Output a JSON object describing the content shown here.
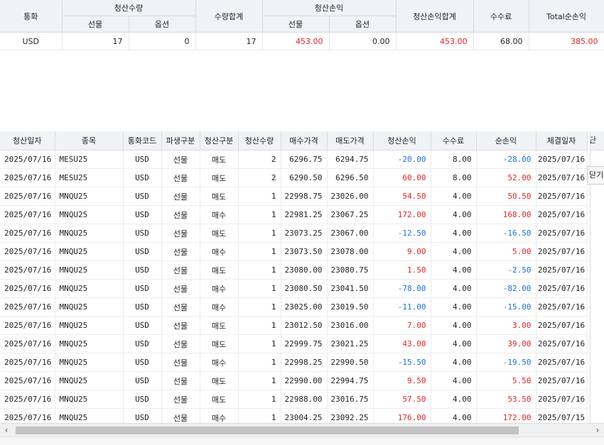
{
  "summary": {
    "headers": {
      "currency": "통화",
      "settle_qty": "청산수량",
      "futures": "선물",
      "options": "옵션",
      "qty_total": "수량합계",
      "settle_pnl": "청산손익",
      "pnl_futures": "선물",
      "pnl_options": "옵션",
      "pnl_total": "청산손익합계",
      "fee": "수수료",
      "total_pnl": "Total순손익"
    },
    "row": {
      "currency": "USD",
      "futures_qty": "17",
      "options_qty": "0",
      "qty_total": "17",
      "pnl_futures": "453.00",
      "pnl_options": "0.00",
      "pnl_total": "453.00",
      "fee": "68.00",
      "total_pnl": "385.00"
    }
  },
  "detail": {
    "headers": [
      "청산일자",
      "종목",
      "통화코드",
      "파생구분",
      "청산구분",
      "청산수량",
      "매수가격",
      "매도가격",
      "청산손익",
      "수수료",
      "순손익",
      "체결일자"
    ],
    "clipped_header": "단",
    "side_button": "닫기",
    "rows": [
      [
        "2025/07/16",
        "MESU25",
        "USD",
        "선물",
        "매도",
        "2",
        "6296.75",
        "6294.75",
        "-20.00",
        "8.00",
        "-28.00",
        "2025/07/16"
      ],
      [
        "2025/07/16",
        "MESU25",
        "USD",
        "선물",
        "매도",
        "2",
        "6290.50",
        "6296.50",
        "60.00",
        "8.00",
        "52.00",
        "2025/07/16"
      ],
      [
        "2025/07/16",
        "MNQU25",
        "USD",
        "선물",
        "매도",
        "1",
        "22998.75",
        "23026.00",
        "54.50",
        "4.00",
        "50.50",
        "2025/07/16"
      ],
      [
        "2025/07/16",
        "MNQU25",
        "USD",
        "선물",
        "매수",
        "1",
        "22981.25",
        "23067.25",
        "172.00",
        "4.00",
        "168.00",
        "2025/07/16"
      ],
      [
        "2025/07/16",
        "MNQU25",
        "USD",
        "선물",
        "매도",
        "1",
        "23073.25",
        "23067.00",
        "-12.50",
        "4.00",
        "-16.50",
        "2025/07/16"
      ],
      [
        "2025/07/16",
        "MNQU25",
        "USD",
        "선물",
        "매수",
        "1",
        "23073.50",
        "23078.00",
        "9.00",
        "4.00",
        "5.00",
        "2025/07/16"
      ],
      [
        "2025/07/16",
        "MNQU25",
        "USD",
        "선물",
        "매도",
        "1",
        "23080.00",
        "23080.75",
        "1.50",
        "4.00",
        "-2.50",
        "2025/07/16"
      ],
      [
        "2025/07/16",
        "MNQU25",
        "USD",
        "선물",
        "매수",
        "1",
        "23080.50",
        "23041.50",
        "-78.00",
        "4.00",
        "-82.00",
        "2025/07/16"
      ],
      [
        "2025/07/16",
        "MNQU25",
        "USD",
        "선물",
        "매수",
        "1",
        "23025.00",
        "23019.50",
        "-11.00",
        "4.00",
        "-15.00",
        "2025/07/16"
      ],
      [
        "2025/07/16",
        "MNQU25",
        "USD",
        "선물",
        "매도",
        "1",
        "23012.50",
        "23016.00",
        "7.00",
        "4.00",
        "3.00",
        "2025/07/16"
      ],
      [
        "2025/07/16",
        "MNQU25",
        "USD",
        "선물",
        "매도",
        "1",
        "22999.75",
        "23021.25",
        "43.00",
        "4.00",
        "39.00",
        "2025/07/16"
      ],
      [
        "2025/07/16",
        "MNQU25",
        "USD",
        "선물",
        "매수",
        "1",
        "22998.25",
        "22990.50",
        "-15.50",
        "4.00",
        "-19.50",
        "2025/07/16"
      ],
      [
        "2025/07/16",
        "MNQU25",
        "USD",
        "선물",
        "매도",
        "1",
        "22990.00",
        "22994.75",
        "9.50",
        "4.00",
        "5.50",
        "2025/07/16"
      ],
      [
        "2025/07/16",
        "MNQU25",
        "USD",
        "선물",
        "매도",
        "1",
        "22988.00",
        "23016.75",
        "57.50",
        "4.00",
        "53.50",
        "2025/07/16"
      ],
      [
        "2025/07/16",
        "MNQU25",
        "USD",
        "선물",
        "매수",
        "1",
        "23004.25",
        "23092.25",
        "176.00",
        "4.00",
        "172.00",
        "2025/07/15"
      ]
    ]
  },
  "scroll": {
    "left_icon": "chevron-left-icon",
    "right_icon": "chevron-right-icon",
    "left_glyph": "‹",
    "right_glyph": "›"
  },
  "colors": {
    "positive": "#e0242a",
    "negative": "#1d6fe0",
    "header_bg": "#f1f2f6"
  }
}
